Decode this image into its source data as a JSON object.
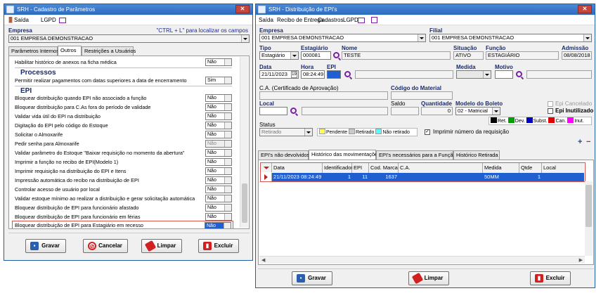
{
  "left_window": {
    "title": "SRH - Cadastro de Parâmetros",
    "menu": {
      "exit": "Saída",
      "lgpd": "LGPD"
    },
    "company_label": "Empresa",
    "company_hint": "\"CTRL + L\" para localizar os campos",
    "company_value": "001 EMPRESA DEMONSTRACAO",
    "tabs": [
      "Parâmetros Internos",
      "Outros",
      "Restrições a Usuários"
    ],
    "rows_top": [
      {
        "label": "Habilitar histórico de anexos na ficha médica",
        "value": "Não"
      }
    ],
    "processos_title": "Processos",
    "rows_processos": [
      {
        "label": "Permitir realizar pagamentos com datas superiores a data de encerramento",
        "value": "Sim"
      }
    ],
    "epi_title": "EPI",
    "rows_epi": [
      {
        "label": "Bloquear distribuição quando EPI não associado a função",
        "value": "Não"
      },
      {
        "label": "Bloquear distribuição para C.As fora do período de validade",
        "value": "Não"
      },
      {
        "label": "Validar vida útil do EPI na distribuição",
        "value": "Não"
      },
      {
        "label": "Digitação do EPI pelo código do Estoque",
        "value": "Não"
      },
      {
        "label": "Solicitar o Almoxarife",
        "value": "Não"
      },
      {
        "label": "Pedir senha para Almoxarife",
        "value": "Não"
      },
      {
        "label": "Validar parâmetro do Estoque \"Baixar requisição no momento da abertura\"",
        "value": "Não"
      },
      {
        "label": "Imprimir a função no recibo de EPI(Modelo 1)",
        "value": "Não"
      },
      {
        "label": "Imprimir requisição na distribuição do EPI e Itens",
        "value": "Não"
      },
      {
        "label": "Impressão automática do recibo na distribuição de EPI",
        "value": "Não"
      },
      {
        "label": "Controlar acesso de usuário por local",
        "value": "Não"
      },
      {
        "label": "Validar estoque mínimo ao realizar a distribuição e gerar solicitação automática",
        "value": "Não"
      },
      {
        "label": "Bloquear distribuição de EPI para funcionário afastado",
        "value": "Não"
      },
      {
        "label": "Bloquear distribuição de EPI para funcionário em férias",
        "value": "Não"
      },
      {
        "label": "Bloquear distribuição de EPI para Estagiário em recesso",
        "value": "Não"
      }
    ],
    "buttons": {
      "save": "Gravar",
      "cancel": "Cancelar",
      "clear": "Limpar",
      "delete": "Excluir"
    }
  },
  "right_window": {
    "title": "SRH - Distribuição de EPI's",
    "menu": {
      "exit": "Saída",
      "receipt": "Recibo de Entrega",
      "registers": "Cadastros",
      "lgpd": "LGPD"
    },
    "labels": {
      "empresa": "Empresa",
      "filial": "Filial",
      "tipo": "Tipo",
      "estagiario": "Estagiário",
      "nome": "Nome",
      "situacao": "Situação",
      "funcao": "Função",
      "admissao": "Admissão",
      "data": "Data",
      "hora": "Hora",
      "epi": "EPI",
      "medida": "Medida",
      "motivo": "Motivo",
      "ca": "C.A. (Certificado de Aprovação)",
      "codigo_material": "Código do Material",
      "local": "Local",
      "saldo": "Saldo",
      "quantidade": "Quantidade",
      "modelo_boleto": "Modelo do Boleto",
      "epi_cancelado": "Epi Cancelado",
      "epi_inutilizado": "Epi Inutilizado",
      "status": "Status",
      "imprimir": "Imprimir número da requisição"
    },
    "values": {
      "empresa": "001 EMPRESA DEMONSTRACAO",
      "filial": "001 EMPRESA DEMONSTRACAO",
      "tipo": "Estagiário",
      "estagiario": "000081",
      "nome": "TESTE",
      "situacao": "ATIVO",
      "funcao": "ESTAGIÁRIO",
      "admissao": "08/08/2018",
      "data": "21/11/2023",
      "hora": "08:24:49",
      "quantidade": "0",
      "modelo_boleto": "02 - Matricial",
      "status": "Retirado"
    },
    "status_legend": [
      {
        "label": "Pendente",
        "color": "#ffff55"
      },
      {
        "label": "Retirado",
        "color": "#c8c8c8"
      },
      {
        "label": "Não retirado",
        "color": "#55ffff"
      }
    ],
    "type_legend": [
      {
        "label": "Ret.",
        "color": "#000000"
      },
      {
        "label": "Dev.",
        "color": "#00a000"
      },
      {
        "label": "Subst.",
        "color": "#0000c0"
      },
      {
        "label": "Can.",
        "color": "#e00000"
      },
      {
        "label": "Inut.",
        "color": "#ff00ff"
      }
    ],
    "tabs": [
      "EPI's não devolvidos",
      "Histórico das movimentações",
      "EPI's necessários para a Função",
      "Histórico Retirada"
    ],
    "grid_headers": [
      "Data",
      "Identificador",
      "EPI",
      "Cod. Marca",
      "C.A.",
      "Medida",
      "Qtde",
      "Local"
    ],
    "grid_rows": [
      {
        "data": "21/11/2023 08:24:49",
        "identificador": "1",
        "epi": "11",
        "cod_marca": "1637",
        "ca": "",
        "medida": "50MM",
        "qtde": "1",
        "local": ""
      }
    ],
    "buttons": {
      "save": "Gravar",
      "clear": "Limpar",
      "delete": "Excluir"
    }
  }
}
